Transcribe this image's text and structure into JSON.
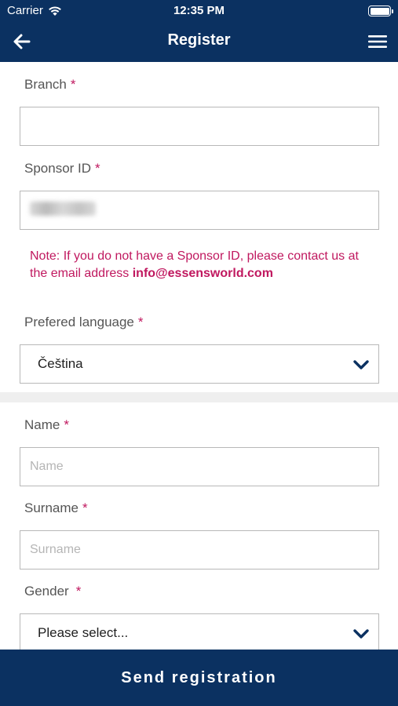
{
  "status_bar": {
    "carrier": "Carrier",
    "time": "12:35 PM"
  },
  "nav": {
    "title": "Register"
  },
  "fields": {
    "branch": {
      "label": "Branch",
      "required": "*",
      "value": ""
    },
    "sponsor_id": {
      "label": "Sponsor ID",
      "required": "*"
    },
    "note": {
      "text": "Note: If you do not have a Sponsor ID, please contact us at the email address ",
      "email": "info@essensworld.com"
    },
    "language": {
      "label": "Prefered language",
      "required": "*",
      "selected": "Čeština"
    },
    "name": {
      "label": "Name",
      "required": "*",
      "placeholder": "Name"
    },
    "surname": {
      "label": "Surname",
      "required": "*",
      "placeholder": "Surname"
    },
    "gender": {
      "label": "Gender",
      "required": "*",
      "selected": "Please select..."
    }
  },
  "footer": {
    "button_label": "Send registration"
  },
  "colors": {
    "primary": "#0b3161",
    "accent": "#c0185f"
  },
  "icons": [
    "wifi-icon",
    "battery-icon",
    "back-arrow-icon",
    "hamburger-menu-icon",
    "chevron-down-icon"
  ]
}
